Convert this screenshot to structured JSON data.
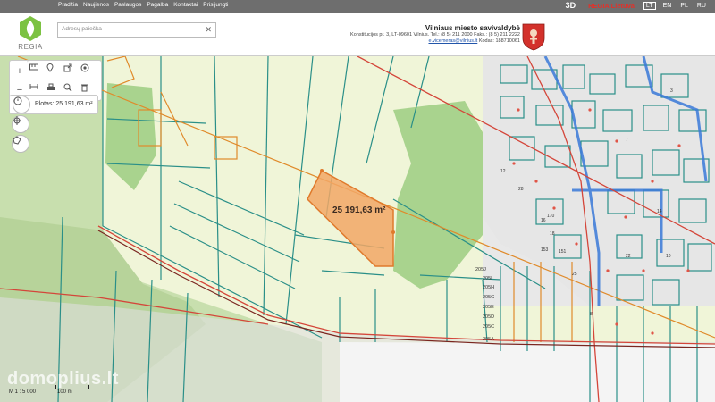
{
  "topnav": {
    "items": [
      "Pradžia",
      "Naujienos",
      "Paslaugos",
      "Pagalba",
      "Kontaktai",
      "Prisijungti"
    ],
    "mode_3d": "3D",
    "brand": "REGIA Lietuva",
    "languages": [
      "LT",
      "EN",
      "PL",
      "RU"
    ],
    "active_language": "LT"
  },
  "header": {
    "logo_text": "REGIA",
    "search_placeholder": "Adresų paieška",
    "municipality_title": "Vilniaus miesto savivaldybė",
    "address_line": "Konstitucijos pr. 3, LT-09601 Vilnius. Tel.: (8 5) 211 2000  Faks.: (8 5) 211 2222",
    "email": "e.vicemeras@vilnius.lt",
    "code_line": "Kodas: 188710061"
  },
  "tools": {
    "area_label": "Plotas: 25 191,63 m²",
    "icons": [
      "zoom-in-icon",
      "zoom-out-icon",
      "ruler-icon",
      "pin-icon",
      "export-icon",
      "target-icon",
      "measure-icon",
      "print-icon",
      "search-layer-icon",
      "trash-icon",
      "history-icon",
      "crosshair-icon",
      "lasso-icon"
    ]
  },
  "map": {
    "selected_area_label": "25 191,63 m²",
    "scale_text": "M 1 : 5 000",
    "scale_bar_label": "100 m",
    "watermark": "domoplius.lt",
    "parcel_labels": [
      "205J",
      "205I",
      "205H",
      "205G",
      "205E",
      "205D",
      "205C",
      "205A"
    ],
    "colors": {
      "selected": "#f2a766",
      "selected_border": "#e07a2c",
      "parcel_line": "#2a8f88",
      "road": "#d4463a",
      "orange_line": "#e08a2a",
      "blue_road": "#3a79d8",
      "forest": "#a9d38e",
      "field": "#f0f5d8",
      "meadow": "#dcecc2"
    }
  }
}
